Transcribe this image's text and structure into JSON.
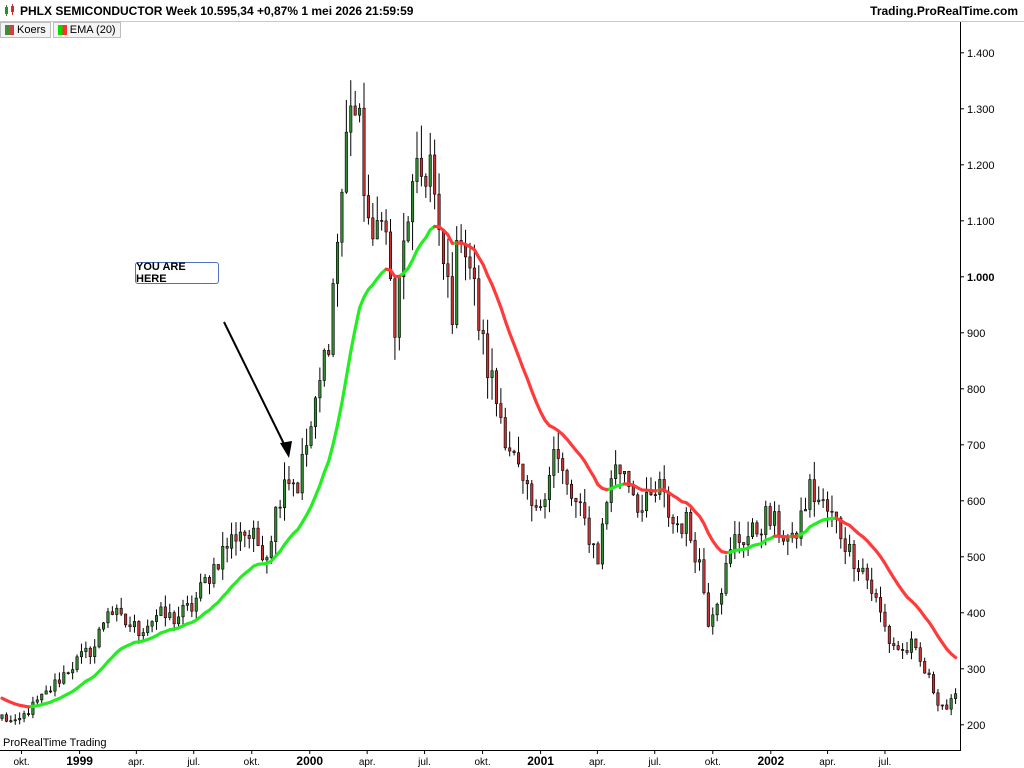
{
  "header": {
    "title": "PHLX SEMICONDUCTOR Week 10.595,34 +0,87% 1 mei 2026 21:59:59",
    "brand": "Trading.ProRealTime.com"
  },
  "legend": [
    {
      "label": "Koers",
      "color_a": "#3b8f3b",
      "color_b": "#d04040"
    },
    {
      "label": "EMA (20)",
      "color_a": "#00dd00",
      "color_b": "#ff3030"
    }
  ],
  "footer": {
    "label": "ProRealTime Trading"
  },
  "annotation": {
    "text": "YOU ARE HERE"
  },
  "colors": {
    "up": "#2e8b2e",
    "down": "#c83232",
    "ema_up": "#22ee22",
    "ema_down": "#ff3a3a"
  },
  "chart_data": {
    "type": "candlestick",
    "y_axis": {
      "side": "right",
      "ylim": [
        155,
        1455
      ],
      "ticks": [
        200,
        300,
        400,
        500,
        600,
        700,
        800,
        900,
        1000,
        1100,
        1200,
        1300,
        1400
      ],
      "tick_labels": [
        "200",
        "300",
        "400",
        "500",
        "600",
        "700",
        "800",
        "900",
        "1.000",
        "1.100",
        "1.200",
        "1.300",
        "1.400"
      ],
      "bold_ticks": [
        "1.000"
      ]
    },
    "x_axis": {
      "start": "1998-08-31",
      "end": "2002-10-28",
      "ticks": [
        {
          "date": "1998-10-01",
          "label": "okt.",
          "year": false
        },
        {
          "date": "1999-01-01",
          "label": "1999",
          "year": true
        },
        {
          "date": "1999-04-01",
          "label": "apr.",
          "year": false
        },
        {
          "date": "1999-07-01",
          "label": "jul.",
          "year": false
        },
        {
          "date": "1999-10-01",
          "label": "okt.",
          "year": false
        },
        {
          "date": "2000-01-01",
          "label": "2000",
          "year": true
        },
        {
          "date": "2000-04-01",
          "label": "apr.",
          "year": false
        },
        {
          "date": "2000-07-01",
          "label": "jul.",
          "year": false
        },
        {
          "date": "2000-10-01",
          "label": "okt.",
          "year": false
        },
        {
          "date": "2001-01-01",
          "label": "2001",
          "year": true
        },
        {
          "date": "2001-04-01",
          "label": "apr.",
          "year": false
        },
        {
          "date": "2001-07-01",
          "label": "jul.",
          "year": false
        },
        {
          "date": "2001-10-01",
          "label": "okt.",
          "year": false
        },
        {
          "date": "2002-01-01",
          "label": "2002",
          "year": true
        },
        {
          "date": "2002-04-01",
          "label": "apr.",
          "year": false
        },
        {
          "date": "2002-07-01",
          "label": "jul.",
          "year": false
        }
      ]
    },
    "anchors": [
      [
        "1998-08-31",
        215
      ],
      [
        "1998-09-21",
        200
      ],
      [
        "1998-10-12",
        225
      ],
      [
        "1998-11-09",
        255
      ],
      [
        "1998-12-14",
        300
      ],
      [
        "1999-01-25",
        340
      ],
      [
        "1999-02-15",
        410
      ],
      [
        "1999-03-08",
        385
      ],
      [
        "1999-04-05",
        370
      ],
      [
        "1999-05-03",
        395
      ],
      [
        "1999-05-31",
        390
      ],
      [
        "1999-06-28",
        410
      ],
      [
        "1999-07-19",
        455
      ],
      [
        "1999-08-16",
        510
      ],
      [
        "1999-09-13",
        550
      ],
      [
        "1999-10-04",
        530
      ],
      [
        "1999-10-25",
        510
      ],
      [
        "1999-11-08",
        580
      ],
      [
        "1999-11-22",
        650
      ],
      [
        "1999-12-13",
        630
      ],
      [
        "1999-12-27",
        700
      ],
      [
        "2000-01-10",
        760
      ],
      [
        "2000-01-31",
        900
      ],
      [
        "2000-02-21",
        1150
      ],
      [
        "2000-03-06",
        1330
      ],
      [
        "2000-03-20",
        1250
      ],
      [
        "2000-04-10",
        1030
      ],
      [
        "2000-04-24",
        1150
      ],
      [
        "2000-05-15",
        900
      ],
      [
        "2000-06-05",
        1120
      ],
      [
        "2000-06-26",
        1180
      ],
      [
        "2000-07-10",
        1210
      ],
      [
        "2000-07-24",
        1050
      ],
      [
        "2000-08-14",
        950
      ],
      [
        "2000-08-28",
        1100
      ],
      [
        "2000-09-11",
        1020
      ],
      [
        "2000-10-02",
        870
      ],
      [
        "2000-10-23",
        780
      ],
      [
        "2000-11-13",
        700
      ],
      [
        "2000-12-04",
        620
      ],
      [
        "2000-12-25",
        570
      ],
      [
        "2001-01-22",
        690
      ],
      [
        "2001-02-12",
        620
      ],
      [
        "2001-03-12",
        560
      ],
      [
        "2001-04-02",
        500
      ],
      [
        "2001-04-23",
        650
      ],
      [
        "2001-05-14",
        660
      ],
      [
        "2001-06-11",
        580
      ],
      [
        "2001-07-09",
        620
      ],
      [
        "2001-07-30",
        560
      ],
      [
        "2001-08-20",
        560
      ],
      [
        "2001-09-10",
        490
      ],
      [
        "2001-09-24",
        390
      ],
      [
        "2001-10-15",
        450
      ],
      [
        "2001-11-05",
        530
      ],
      [
        "2001-12-03",
        540
      ],
      [
        "2001-12-24",
        570
      ],
      [
        "2002-01-14",
        550
      ],
      [
        "2002-02-04",
        520
      ],
      [
        "2002-03-04",
        620
      ],
      [
        "2002-03-25",
        590
      ],
      [
        "2002-04-15",
        560
      ],
      [
        "2002-05-06",
        510
      ],
      [
        "2002-05-27",
        480
      ],
      [
        "2002-06-17",
        420
      ],
      [
        "2002-07-08",
        350
      ],
      [
        "2002-07-29",
        330
      ],
      [
        "2002-08-12",
        340
      ],
      [
        "2002-08-26",
        310
      ],
      [
        "2002-09-09",
        280
      ],
      [
        "2002-09-23",
        245
      ],
      [
        "2002-10-07",
        230
      ],
      [
        "2002-10-21",
        245
      ]
    ],
    "ema_period": 20
  }
}
